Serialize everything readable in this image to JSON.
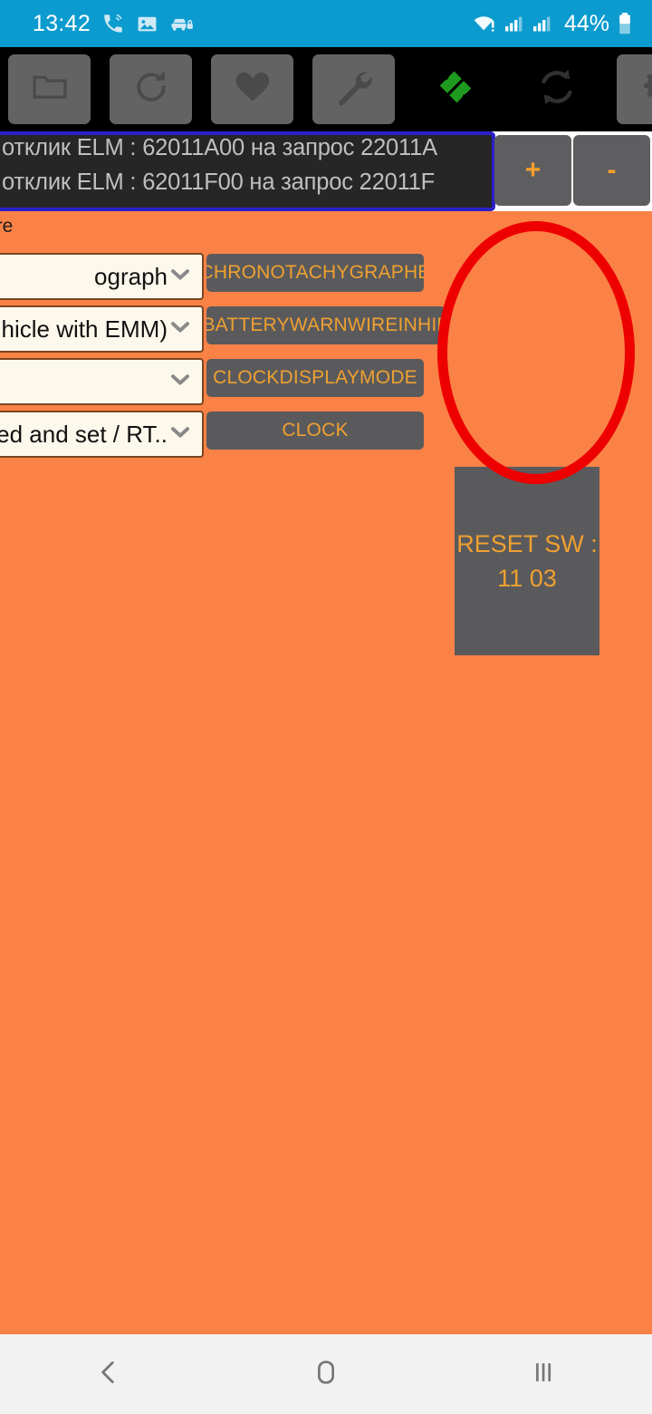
{
  "status_bar": {
    "clock": "13:42",
    "battery_percent": "44%",
    "left_icons": [
      "call-icon",
      "image-icon",
      "car-lock-icon"
    ],
    "right_icons": [
      "wifi-alert-icon",
      "signal-sim1-icon",
      "signal-sim2-icon",
      "battery-icon"
    ],
    "background_color": "#0B9BCE"
  },
  "toolbar": {
    "background_color": "#000000",
    "buttons": [
      {
        "name": "folder-button",
        "icon": "folder-icon",
        "style": "raised"
      },
      {
        "name": "reload-button",
        "icon": "refresh-icon",
        "style": "raised"
      },
      {
        "name": "favorite-button",
        "icon": "heart-icon",
        "style": "raised"
      },
      {
        "name": "tools-button",
        "icon": "wrench-icon",
        "style": "raised"
      },
      {
        "name": "connection-button",
        "icon": "plug-connected-icon",
        "style": "flat"
      },
      {
        "name": "sync-button",
        "icon": "sync-icon",
        "style": "flat"
      },
      {
        "name": "settings-button",
        "icon": "gear-icon",
        "style": "raised"
      }
    ]
  },
  "log": {
    "border_color": "#2B20C8",
    "lines": [
      "отклик ELM : 62011A00 на запрос 22011A",
      "отклик ELM : 62011F00 на запрос 22011F"
    ]
  },
  "zoom_controls": {
    "increase_label": "+",
    "decrease_label": "-"
  },
  "content": {
    "background_color": "#FA8246",
    "section_label": "ure",
    "dropdowns": [
      {
        "name": "dropdown-chronotachygraph",
        "value": "ograph"
      },
      {
        "name": "dropdown-vehicle-type",
        "value": "hicle with EMM)"
      },
      {
        "name": "dropdown-empty",
        "value": ""
      },
      {
        "name": "dropdown-clock-mode",
        "value": "red and set / RT.."
      }
    ],
    "action_buttons": [
      {
        "name": "button-chronotachygraphe",
        "label": "CHRONOTACHYGRAPHE"
      },
      {
        "name": "button-batterywarnwireinhib",
        "label": "BATTERYWARNWIREINHIB"
      },
      {
        "name": "button-clockdisplaymode",
        "label": "CLOCKDISPLAYMODE"
      },
      {
        "name": "button-clock",
        "label": "CLOCK"
      }
    ],
    "reset_panel": {
      "line1": "RESET SW :",
      "line2": "11 03",
      "background_color": "#5A5A5C",
      "text_color": "#F0A030"
    },
    "annotation": {
      "shape": "ellipse",
      "color": "#EE0000"
    }
  },
  "nav_bar": {
    "background_color": "#F2F2F2",
    "buttons": [
      {
        "name": "nav-back-button",
        "icon": "chevron-left-icon"
      },
      {
        "name": "nav-home-button",
        "icon": "home-square-icon"
      },
      {
        "name": "nav-recents-button",
        "icon": "recents-bars-icon"
      }
    ]
  }
}
